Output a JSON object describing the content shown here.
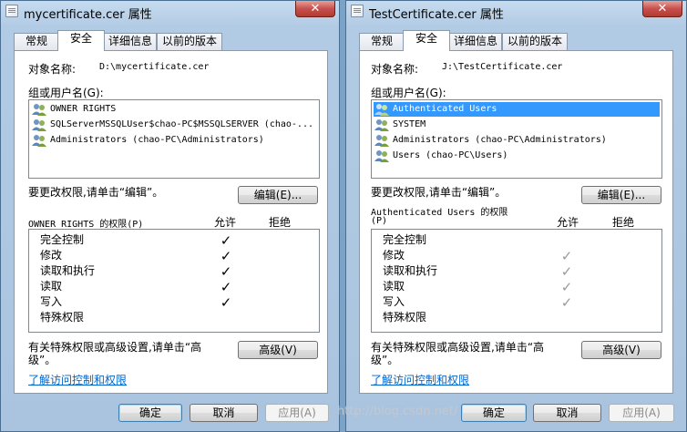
{
  "dialogs": [
    {
      "title": "mycertificate.cer 属性",
      "close": "✕",
      "tabs": [
        {
          "label": "常规"
        },
        {
          "label": "安全"
        },
        {
          "label": "详细信息"
        },
        {
          "label": "以前的版本"
        }
      ],
      "active_tab": "安全",
      "object_label": "对象名称:",
      "object_value": "D:\\mycertificate.cer",
      "group_label": "组或用户名(G):",
      "principals": [
        {
          "name": "OWNER RIGHTS",
          "icon": "users-icon",
          "selected": false
        },
        {
          "name": "SQLServerMSSQLUser$chao-PC$MSSQLSERVER (chao-...",
          "icon": "users-icon",
          "selected": false
        },
        {
          "name": "Administrators (chao-PC\\Administrators)",
          "icon": "users-icon",
          "selected": false
        }
      ],
      "change_hint": "要更改权限,请单击“编辑”。",
      "edit_button": "编辑(E)...",
      "perm_title": "OWNER RIGHTS 的权限(P)",
      "allow_header": "允许",
      "deny_header": "拒绝",
      "permissions": [
        {
          "name": "完全控制",
          "allow": "✓",
          "deny": "",
          "allow_gray": false
        },
        {
          "name": "修改",
          "allow": "✓",
          "deny": "",
          "allow_gray": false
        },
        {
          "name": "读取和执行",
          "allow": "✓",
          "deny": "",
          "allow_gray": false
        },
        {
          "name": "读取",
          "allow": "✓",
          "deny": "",
          "allow_gray": false
        },
        {
          "name": "写入",
          "allow": "✓",
          "deny": "",
          "allow_gray": false
        },
        {
          "name": "特殊权限",
          "allow": "",
          "deny": "",
          "allow_gray": false
        }
      ],
      "advanced_hint_1": "有关特殊权限或高级设置,请单击“高",
      "advanced_hint_2": "级”。",
      "advanced_button": "高级(V)",
      "learn_link": "了解访问控制和权限",
      "ok_button": "确定",
      "cancel_button": "取消",
      "apply_button": "应用(A)"
    },
    {
      "title": "TestCertificate.cer 属性",
      "close": "✕",
      "tabs": [
        {
          "label": "常规"
        },
        {
          "label": "安全"
        },
        {
          "label": "详细信息"
        },
        {
          "label": "以前的版本"
        }
      ],
      "active_tab": "安全",
      "object_label": "对象名称:",
      "object_value": "J:\\TestCertificate.cer",
      "group_label": "组或用户名(G):",
      "principals": [
        {
          "name": "Authenticated Users",
          "icon": "users-icon",
          "selected": true
        },
        {
          "name": "SYSTEM",
          "icon": "users-icon",
          "selected": false
        },
        {
          "name": "Administrators (chao-PC\\Administrators)",
          "icon": "users-icon",
          "selected": false
        },
        {
          "name": "Users (chao-PC\\Users)",
          "icon": "users-icon",
          "selected": false
        }
      ],
      "change_hint": "要更改权限,请单击“编辑”。",
      "edit_button": "编辑(E)...",
      "perm_title_1": "Authenticated Users 的权限",
      "perm_title_2": "(P)",
      "allow_header": "允许",
      "deny_header": "拒绝",
      "permissions": [
        {
          "name": "完全控制",
          "allow": "",
          "deny": "",
          "allow_gray": true
        },
        {
          "name": "修改",
          "allow": "✓",
          "deny": "",
          "allow_gray": true
        },
        {
          "name": "读取和执行",
          "allow": "✓",
          "deny": "",
          "allow_gray": true
        },
        {
          "name": "读取",
          "allow": "✓",
          "deny": "",
          "allow_gray": true
        },
        {
          "name": "写入",
          "allow": "✓",
          "deny": "",
          "allow_gray": true
        },
        {
          "name": "特殊权限",
          "allow": "",
          "deny": "",
          "allow_gray": true
        }
      ],
      "advanced_hint_1": "有关特殊权限或高级设置,请单击“高",
      "advanced_hint_2": "级”。",
      "advanced_button": "高级(V)",
      "learn_link": "了解访问控制和权限",
      "ok_button": "确定",
      "cancel_button": "取消",
      "apply_button": "应用(A)"
    }
  ],
  "watermark": "http://blog.csdn.net/"
}
